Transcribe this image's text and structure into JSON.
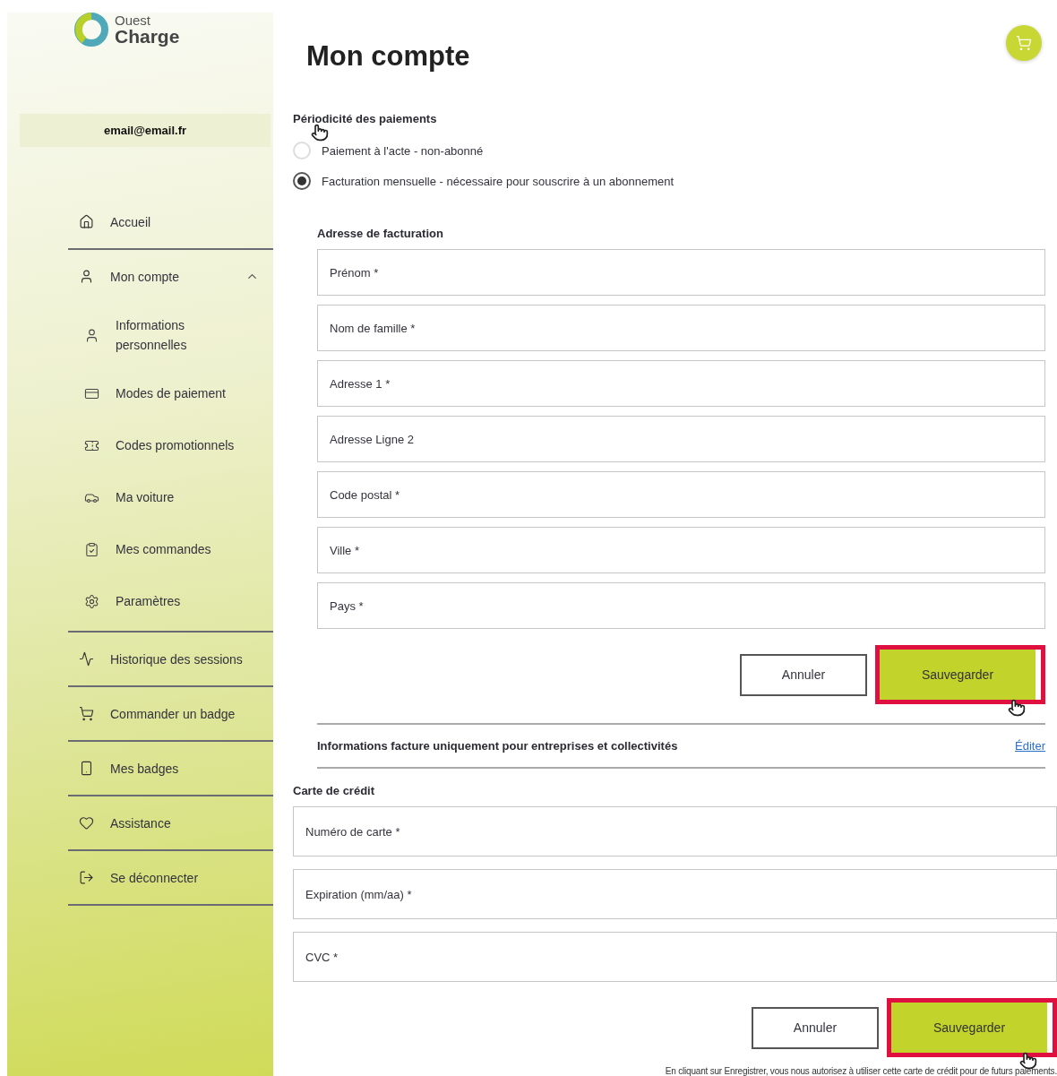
{
  "logo": {
    "line_1": "Ouest",
    "line_2": "Charge"
  },
  "sidebar": {
    "email": "email@email.fr",
    "items": [
      {
        "label": "Accueil"
      },
      {
        "label": "Mon compte",
        "expanded": true,
        "children": [
          {
            "label": "Informations personnelles"
          },
          {
            "label": "Modes de paiement"
          },
          {
            "label": "Codes promotionnels"
          },
          {
            "label": "Ma voiture"
          },
          {
            "label": "Mes commandes"
          },
          {
            "label": "Paramètres"
          }
        ]
      },
      {
        "label": "Historique des sessions"
      },
      {
        "label": "Commander un badge"
      },
      {
        "label": "Mes badges"
      },
      {
        "label": "Assistance"
      },
      {
        "label": "Se déconnecter"
      }
    ]
  },
  "page_title": "Mon compte",
  "payment": {
    "heading": "Périodicité des paiements",
    "options": [
      {
        "label": "Paiement à l'acte - non-abonné",
        "selected": false
      },
      {
        "label": "Facturation mensuelle - nécessaire pour souscrire à un abonnement",
        "selected": true
      }
    ]
  },
  "billing": {
    "heading": "Adresse de facturation",
    "fields": [
      {
        "placeholder": "Prénom *"
      },
      {
        "placeholder": "Nom de famille *"
      },
      {
        "placeholder": "Adresse 1 *"
      },
      {
        "placeholder": "Adresse Ligne 2"
      },
      {
        "placeholder": "Code postal *"
      },
      {
        "placeholder": "Ville *"
      },
      {
        "placeholder": "Pays *"
      }
    ],
    "cancel": "Annuler",
    "save": {
      "label": "Sauvegarder",
      "highlighted": true
    }
  },
  "company_info": {
    "label": "Informations facture uniquement pour entreprises et collectivités",
    "link": "Éditer"
  },
  "card": {
    "heading": "Carte de crédit",
    "fields": [
      {
        "placeholder": "Numéro de carte *"
      },
      {
        "placeholder": "Expiration (mm/aa) *"
      },
      {
        "placeholder": "CVC *"
      }
    ],
    "cancel": "Annuler",
    "save": {
      "label": "Sauvegarder",
      "highlighted": true
    },
    "note": "En cliquant sur Enregistrer, vous nous autorisez à utiliser cette carte de crédit pour de futurs paiements."
  }
}
